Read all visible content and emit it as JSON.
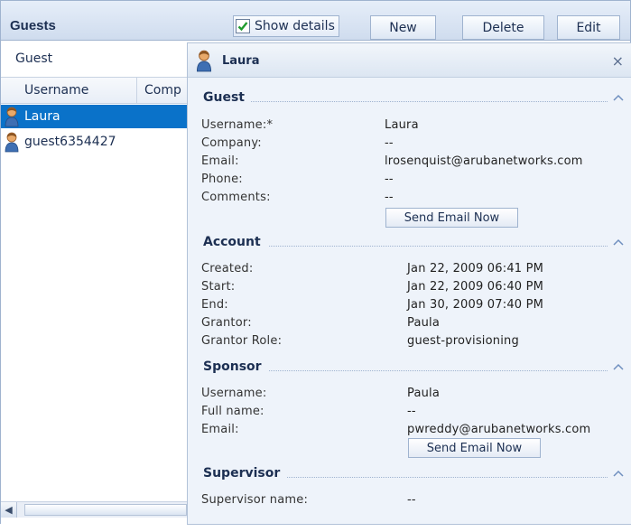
{
  "toolbar": {
    "title": "Guests",
    "show_details_label": "Show details",
    "show_details_checked": true,
    "new_label": "New",
    "delete_label": "Delete",
    "edit_label": "Edit"
  },
  "list": {
    "group_header": "Guest",
    "columns": [
      "Username",
      "Comp"
    ],
    "rows": [
      {
        "username": "Laura",
        "selected": true
      },
      {
        "username": "guest6354427",
        "selected": false
      }
    ]
  },
  "detail": {
    "title": "Laura",
    "close_glyph": "×",
    "sections": {
      "guest": {
        "title": "Guest",
        "labels": [
          "Username:*",
          "Company:",
          "Email:",
          "Phone:",
          "Comments:"
        ],
        "values": [
          "Laura",
          "--",
          "lrosenquist@arubanetworks.com",
          "--",
          "--"
        ],
        "button": "Send Email Now"
      },
      "account": {
        "title": "Account",
        "labels": [
          "Created:",
          "Start:",
          "End:",
          "Grantor:",
          "Grantor Role:"
        ],
        "values": [
          "Jan 22, 2009 06:41 PM",
          "Jan 22, 2009 06:40 PM",
          "Jan 30, 2009 07:40 PM",
          "Paula",
          "guest-provisioning"
        ]
      },
      "sponsor": {
        "title": "Sponsor",
        "labels": [
          "Username:",
          "Full name:",
          "Email:"
        ],
        "values": [
          "Paula",
          "--",
          "pwreddy@arubanetworks.com"
        ],
        "button": "Send Email Now"
      },
      "supervisor": {
        "title": "Supervisor",
        "labels": [
          "Supervisor name:"
        ],
        "values": [
          "--"
        ]
      }
    }
  },
  "colors": {
    "selection": "#0a72c9",
    "accent": "#1c2f52",
    "panel_bg": "#eef3fa"
  },
  "icons": {
    "avatar": "user-avatar-icon",
    "collapse": "chevron-up-icon",
    "close": "close-icon"
  }
}
